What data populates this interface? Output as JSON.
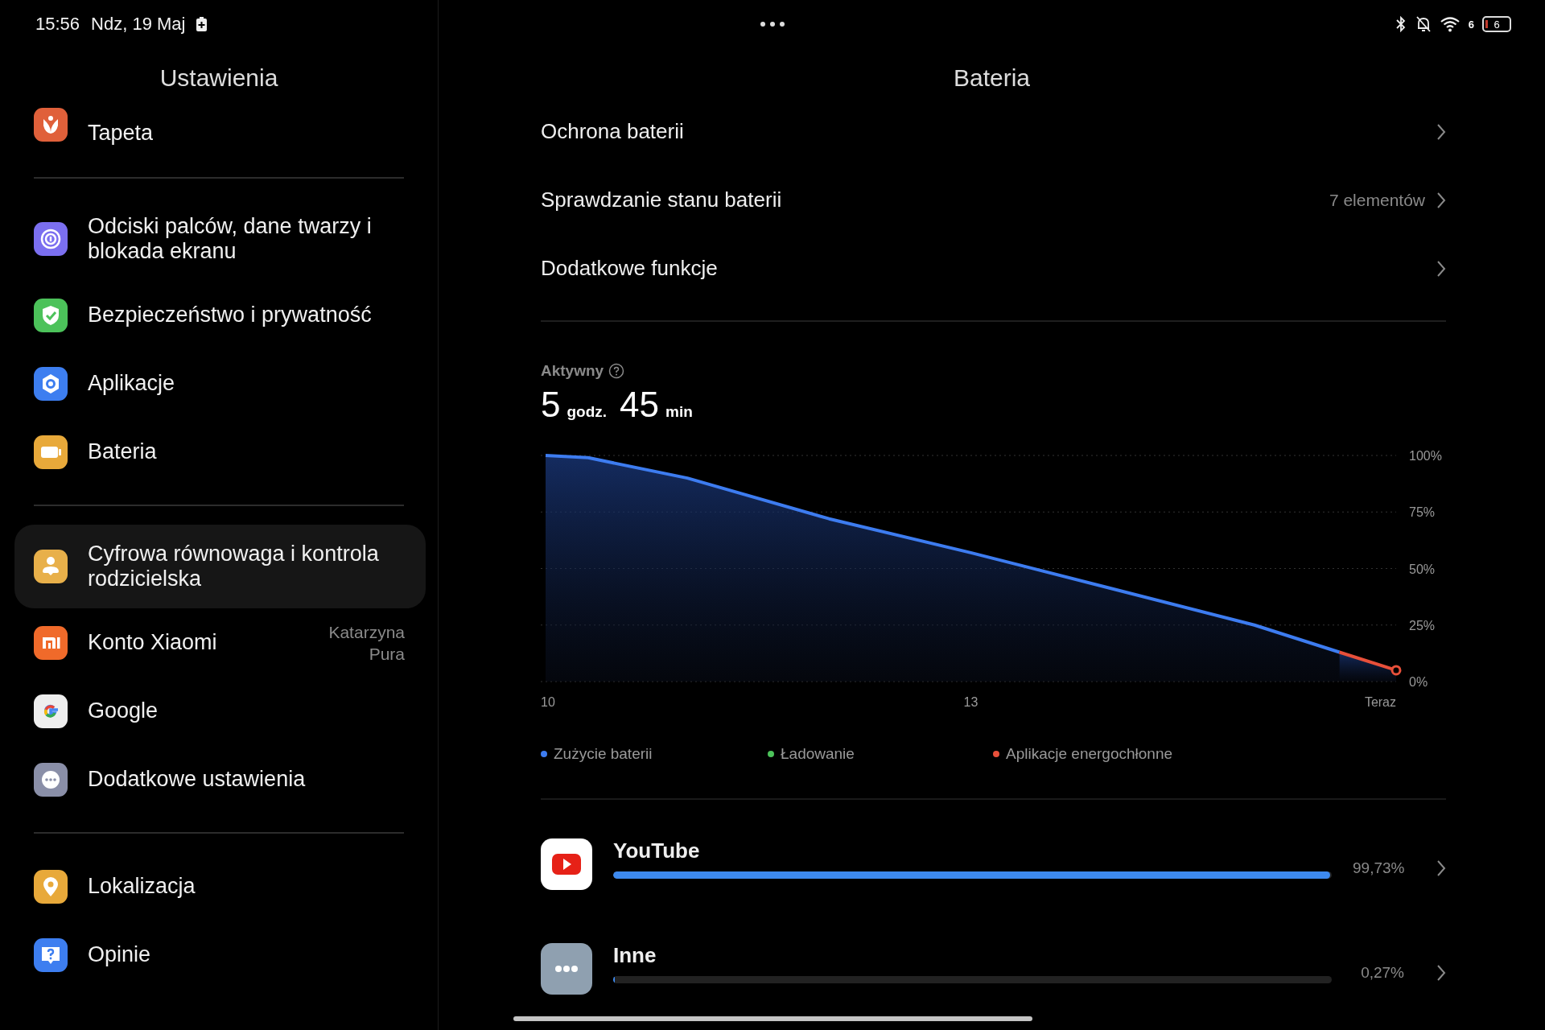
{
  "status_bar": {
    "time": "15:56",
    "date": "Ndz, 19 Maj",
    "wifi_badge": "6",
    "battery": "6"
  },
  "sidebar": {
    "title": "Ustawienia",
    "groups": [
      [
        {
          "label": "Tapeta",
          "selected": false
        }
      ],
      [
        {
          "label": "Odciski palców, dane twarzy i blokada ekranu",
          "selected": false
        },
        {
          "label": "Bezpieczeństwo i prywatność",
          "selected": false
        },
        {
          "label": "Aplikacje",
          "selected": false
        },
        {
          "label": "Bateria",
          "selected": false
        }
      ],
      [
        {
          "label": "Cyfrowa równowaga i kontrola rodzicielska",
          "selected": true
        },
        {
          "label": "Konto Xiaomi",
          "detail": "Katarzyna Pura",
          "selected": false
        },
        {
          "label": "Google",
          "selected": false
        },
        {
          "label": "Dodatkowe ustawienia",
          "selected": false
        }
      ],
      [
        {
          "label": "Lokalizacja",
          "selected": false
        },
        {
          "label": "Opinie",
          "selected": false
        }
      ]
    ]
  },
  "battery": {
    "title": "Bateria",
    "rows": [
      {
        "label": "Ochrona baterii"
      },
      {
        "label": "Sprawdzanie stanu baterii",
        "value": "7 elementów"
      },
      {
        "label": "Dodatkowe funkcje"
      }
    ],
    "active": {
      "label": "Aktywny",
      "hours": "5",
      "hours_unit": "godz.",
      "minutes": "45",
      "minutes_unit": "min"
    },
    "chart_data": {
      "type": "area",
      "grid": true,
      "x": [
        10,
        10.3,
        11,
        12,
        13,
        14,
        15,
        15.6,
        16
      ],
      "xlim": [
        10,
        16
      ],
      "ylim": [
        0,
        100
      ],
      "xticks": [
        {
          "value": 10,
          "label": "10"
        },
        {
          "value": 13,
          "label": "13"
        },
        {
          "value": 16,
          "label": "Teraz"
        }
      ],
      "yticks": [
        {
          "value": 100,
          "label": "100%"
        },
        {
          "value": 75,
          "label": "75%"
        },
        {
          "value": 50,
          "label": "50%"
        },
        {
          "value": 25,
          "label": "25%"
        },
        {
          "value": 0,
          "label": "0%"
        }
      ],
      "series": [
        {
          "name": "Zużycie baterii",
          "color": "#3d7cf0",
          "values": [
            100,
            99,
            90,
            72,
            57,
            41,
            25,
            13,
            null
          ]
        },
        {
          "name": "Ładowanie",
          "color": "#4cc25a",
          "values": [
            null,
            null,
            null,
            null,
            null,
            null,
            null,
            null,
            null
          ]
        },
        {
          "name": "Aplikacje energochłonne",
          "color": "#e8503a",
          "values": [
            null,
            null,
            null,
            null,
            null,
            null,
            null,
            13,
            5
          ]
        }
      ]
    },
    "apps": [
      {
        "name": "YouTube",
        "percent": "99,73%",
        "level": 0.9973
      },
      {
        "name": "Inne",
        "percent": "0,27%",
        "level": 0.0027
      }
    ]
  }
}
